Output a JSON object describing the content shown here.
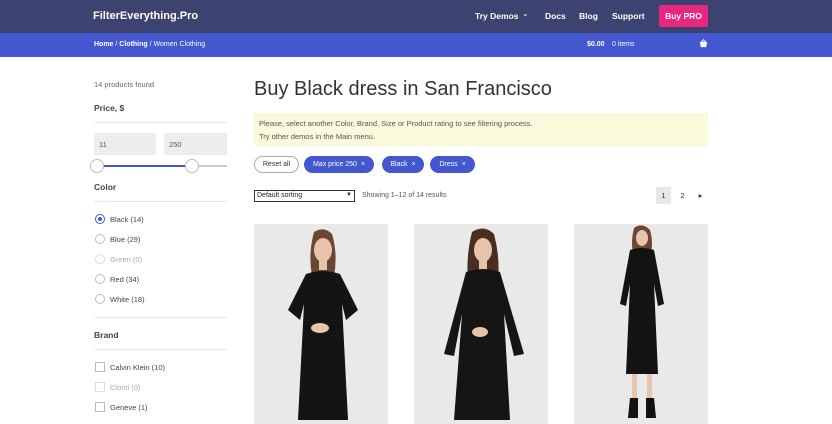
{
  "header": {
    "logo": "FilterEverything.Pro",
    "nav": [
      {
        "label": "Try Demos"
      },
      {
        "label": "Docs"
      },
      {
        "label": "Blog"
      },
      {
        "label": "Support"
      }
    ],
    "buy_label": "Buy PRO"
  },
  "breadcrumb": {
    "home": "Home",
    "sep1": " / ",
    "clothing": "Clothing",
    "sep2": " / ",
    "current": "Women Clothing"
  },
  "cart": {
    "total": "$0.00",
    "items": "0 items"
  },
  "sidebar": {
    "found": "14 products found",
    "price": {
      "title": "Price, $",
      "min": "11",
      "max": "250",
      "min_level": 0.0,
      "max_level": 1.0
    },
    "color": {
      "title": "Color",
      "options": [
        {
          "label": "Black (14)",
          "selected": true,
          "disabled": false
        },
        {
          "label": "Blue (29)",
          "selected": false,
          "disabled": false
        },
        {
          "label": "Green (0)",
          "selected": false,
          "disabled": true
        },
        {
          "label": "Red (34)",
          "selected": false,
          "disabled": false
        },
        {
          "label": "White (18)",
          "selected": false,
          "disabled": false
        }
      ]
    },
    "brand": {
      "title": "Brand",
      "options": [
        {
          "label": "Calvin Klein (10)",
          "checked": false,
          "disabled": false
        },
        {
          "label": "Clonti (0)",
          "checked": false,
          "disabled": true
        },
        {
          "label": "Geneve (1)",
          "checked": false,
          "disabled": false
        }
      ]
    }
  },
  "main": {
    "title": "Buy Black dress in San Francisco",
    "notice_line1": "Please, select another Color, Brand, Size or Product rating to see filtering process.",
    "notice_line2": "Try other demos in the Main menu.",
    "chips": {
      "reset": "Reset all",
      "active": [
        {
          "label": "Max price 250"
        },
        {
          "label": "Black"
        },
        {
          "label": "Dress"
        }
      ],
      "remove_glyph": "×"
    },
    "sorting": "Default sorting",
    "showing": "Showing 1–12 of 14 results",
    "pagination": [
      "1",
      "2"
    ],
    "next_glyph": "▸"
  },
  "colors": {
    "topbar": "#3d4370",
    "crumbbar": "#4357cf",
    "accent": "#4357cf",
    "buy": "#e92680",
    "notice": "#fbf9db"
  },
  "icons": {
    "cart": "basket-icon",
    "caret": "chevron-down-icon"
  }
}
